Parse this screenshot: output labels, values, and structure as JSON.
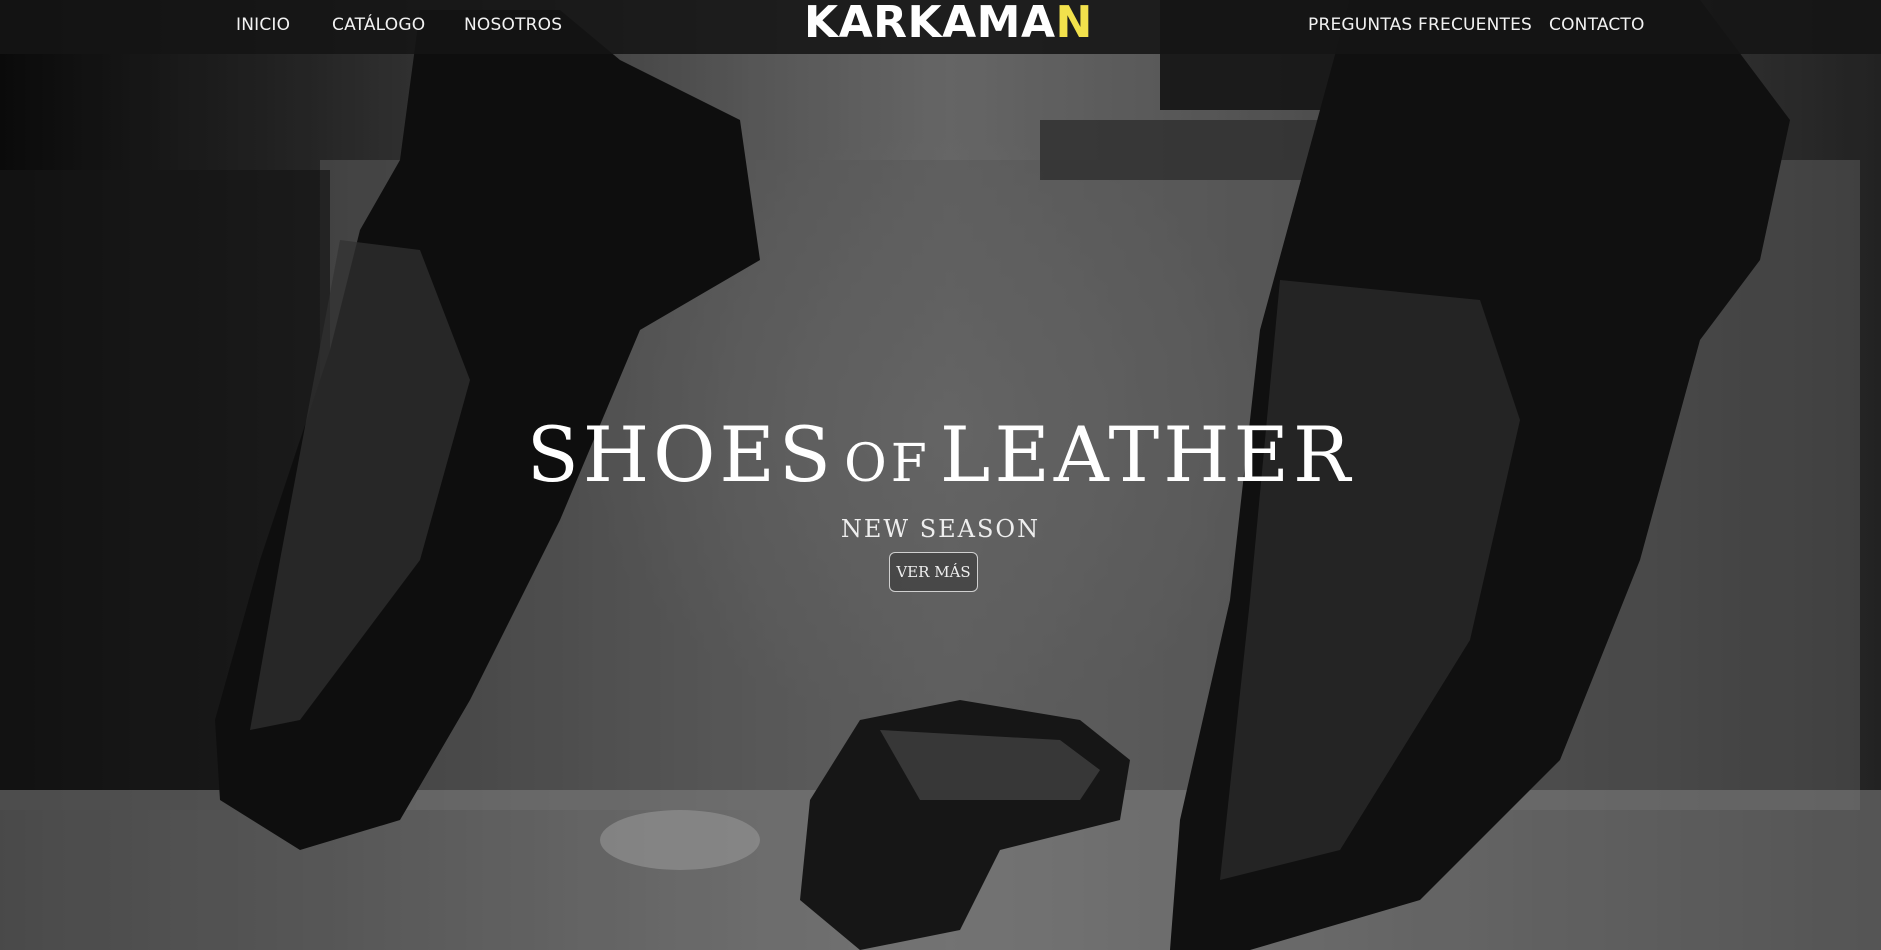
{
  "nav": {
    "left": [
      "INICIO",
      "CATÁLOGO",
      "NOSOTROS"
    ],
    "right": [
      "PREGUNTAS FRECUENTES",
      "CONTACTO"
    ]
  },
  "brand": {
    "main": "KARKAMA",
    "accent": "N",
    "accent_color": "#f2e14c"
  },
  "hero": {
    "headline_part1": "SHOES",
    "headline_part2": "OF",
    "headline_part3": "LEATHER",
    "subheadline": "NEW SEASON",
    "cta_label": "VER MÁS",
    "background_image": "black-leather-loafers-and-belt-photo"
  }
}
